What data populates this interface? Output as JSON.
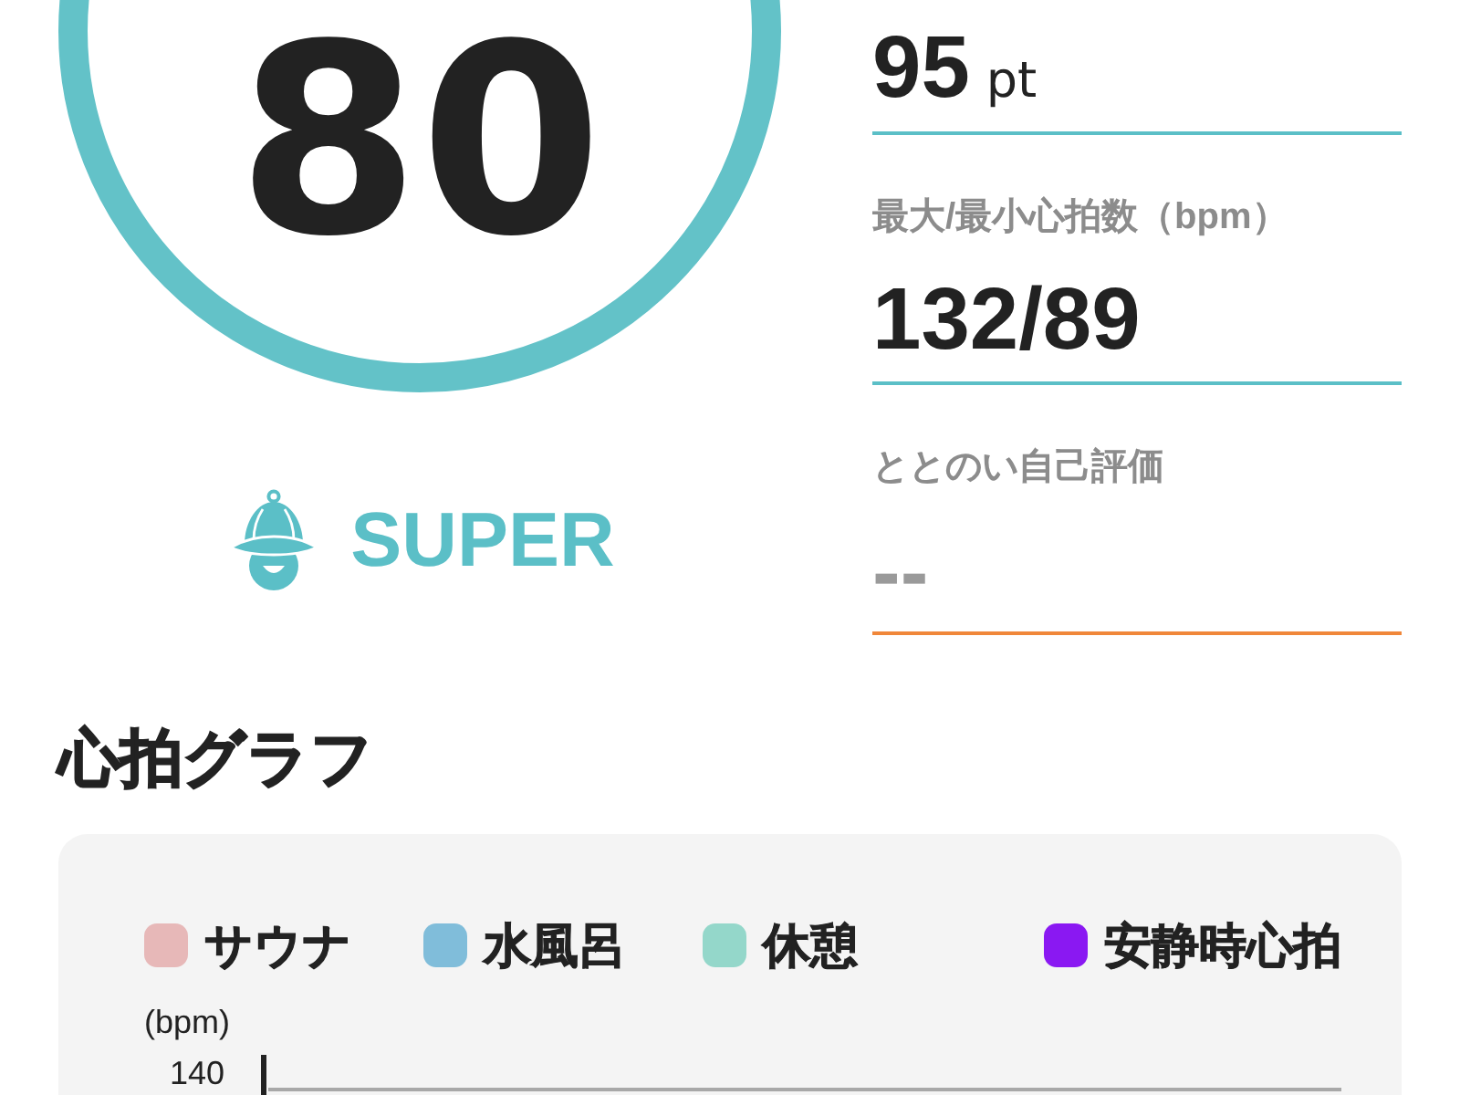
{
  "score": {
    "value": "80"
  },
  "rank": {
    "label": "SUPER"
  },
  "metrics": [
    {
      "kind": "value",
      "value": "95",
      "unit": "pt"
    },
    {
      "kind": "value",
      "label": "最大/最小心拍数（bpm）",
      "value": "132/89"
    },
    {
      "kind": "input",
      "label": "ととのい自己評価",
      "placeholder": "--"
    }
  ],
  "section_title": "心拍グラフ",
  "chart": {
    "legend": [
      {
        "label": "サウナ",
        "color": "#e7b8b8"
      },
      {
        "label": "水風呂",
        "color": "#80bdda"
      },
      {
        "label": "休憩",
        "color": "#94d7ca"
      },
      {
        "label": "安静時心拍",
        "color": "#8a18f2"
      }
    ],
    "y_axis_label": "(bpm)",
    "y_tick_labels": [
      "140"
    ]
  }
}
